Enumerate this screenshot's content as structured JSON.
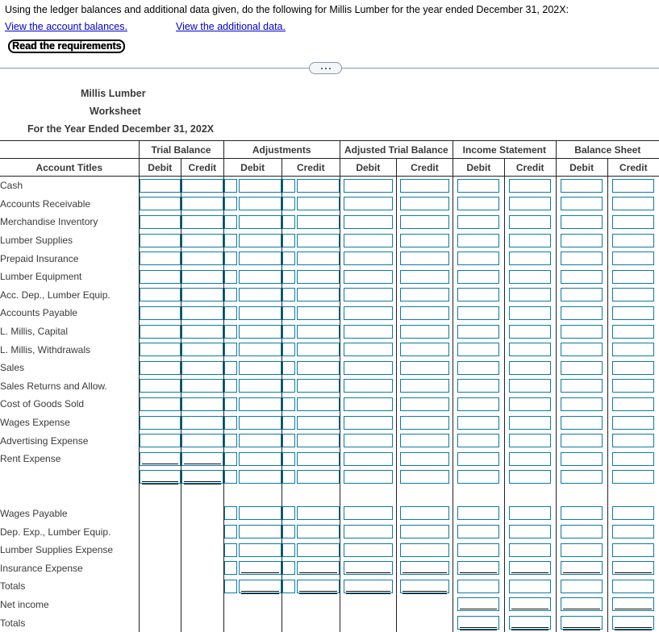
{
  "prompt": {
    "statement": "Using the ledger balances and additional data given, do the following for Millis Lumber for the year ended December 31, 202X:",
    "link_balances": "View the account balances.",
    "link_additional": "View the additional data.",
    "requirements_link": "Read the requirements"
  },
  "divider": {
    "ellipsis_label": "..."
  },
  "worksheet": {
    "company": "Millis Lumber",
    "kind": "Worksheet",
    "period": "For the Year Ended December 31, 202X",
    "account_titles_header": "Account Titles",
    "column_groups": [
      {
        "label": "Trial Balance",
        "debit": "Debit",
        "credit": "Credit"
      },
      {
        "label": "Adjustments",
        "debit": "Debit",
        "credit": "Credit"
      },
      {
        "label": "Adjusted Trial Balance",
        "debit": "Debit",
        "credit": "Credit"
      },
      {
        "label": "Income Statement",
        "debit": "Debit",
        "credit": "Credit"
      },
      {
        "label": "Balance Sheet",
        "debit": "Debit",
        "credit": "Credit"
      }
    ],
    "rows": [
      {
        "title": "Cash"
      },
      {
        "title": "Accounts Receivable"
      },
      {
        "title": "Merchandise Inventory"
      },
      {
        "title": "Lumber Supplies"
      },
      {
        "title": "Prepaid Insurance"
      },
      {
        "title": "Lumber Equipment"
      },
      {
        "title": "Acc. Dep., Lumber Equip."
      },
      {
        "title": "Accounts Payable"
      },
      {
        "title": "L. Millis, Capital"
      },
      {
        "title": "L. Millis, Withdrawals"
      },
      {
        "title": "Sales"
      },
      {
        "title": "Sales Returns and Allow."
      },
      {
        "title": "Cost of Goods Sold"
      },
      {
        "title": "Wages Expense"
      },
      {
        "title": "Advertising Expense"
      },
      {
        "title": "Rent Expense"
      },
      {
        "title": ""
      },
      {
        "title": ""
      },
      {
        "title": "Wages Payable"
      },
      {
        "title": "Dep. Exp., Lumber Equip."
      },
      {
        "title": "Lumber Supplies Expense"
      },
      {
        "title": "Insurance Expense"
      },
      {
        "title": "Totals"
      },
      {
        "title": "Net income"
      },
      {
        "title": "Totals"
      }
    ],
    "colors": {
      "input_border": "#0b7ba3",
      "grid_line": "#222222",
      "link": "#0000cc",
      "heading_text": "#3a3a3a"
    }
  }
}
